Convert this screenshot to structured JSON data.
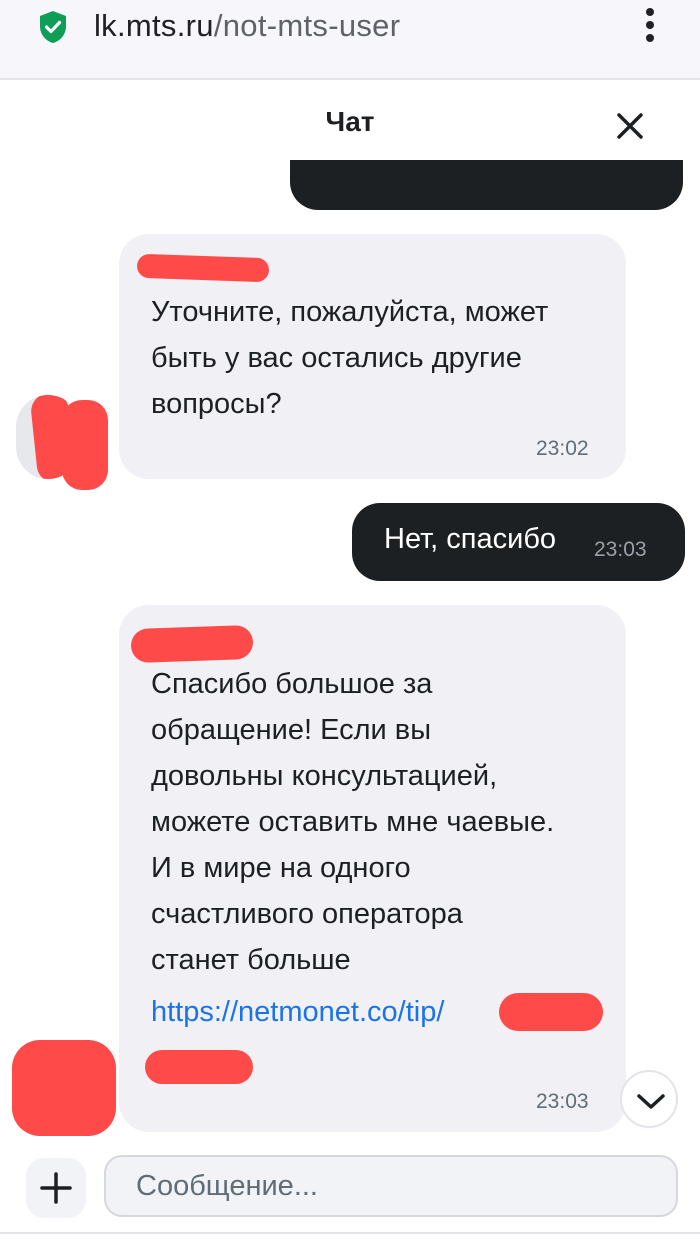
{
  "browser": {
    "url_host": "lk.mts.ru",
    "url_path": "/not-mts-user"
  },
  "chat": {
    "title": "Чат"
  },
  "messages": [
    {
      "direction": "incoming",
      "text": "Уточните, пожалуйста, может\nбыть у вас остались другие\nвопросы?",
      "time": "23:02"
    },
    {
      "direction": "outgoing",
      "text": "Нет, спасибо",
      "time": "23:03"
    },
    {
      "direction": "incoming",
      "text": "Спасибо большое за\nобращение! Если вы\nдовольны консультацией,\nможете оставить мне чаевые.\nИ в мире на одного\nсчастливого оператора\nстанет больше",
      "link": "https://netmonet.co/tip/",
      "time": "23:03"
    }
  ],
  "composer": {
    "placeholder": "Сообщение..."
  },
  "colors": {
    "dark_bubble": "#1d2023",
    "light_bubble": "#f0f0f5",
    "link": "#1a73e8",
    "redaction": "#ff4a4a",
    "secure_green": "#0f9d58"
  }
}
